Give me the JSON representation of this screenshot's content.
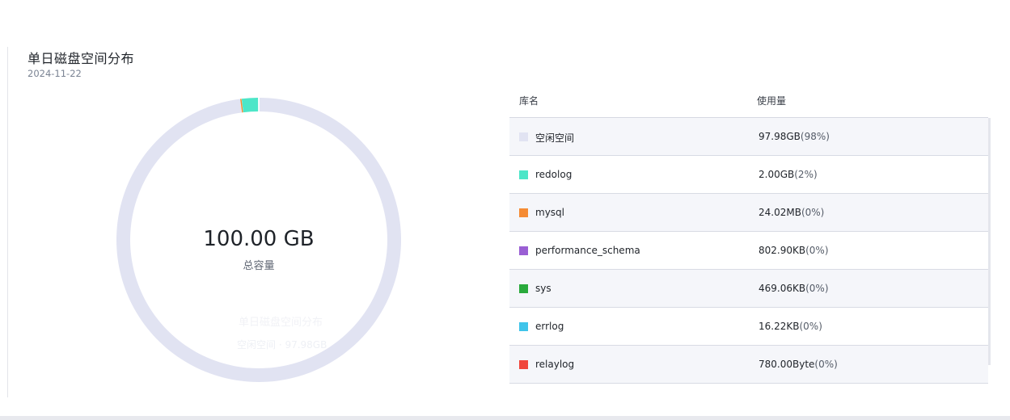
{
  "header": {
    "title": "单日磁盘空间分布",
    "date": "2024-11-22"
  },
  "donut": {
    "total_value": "100.00 GB",
    "total_label": "总容量",
    "ghost_title": "单日磁盘空间分布",
    "ghost_sub": "空闲空间 · 97.98GB"
  },
  "table": {
    "columns": [
      "库名",
      "使用量"
    ],
    "rows": [
      {
        "name": "空闲空间",
        "amount": "97.98GB",
        "pct": "(98%)",
        "color": "#e1e3f2",
        "value_gb": 97.98
      },
      {
        "name": "redolog",
        "amount": "2.00GB",
        "pct": "(2%)",
        "color": "#4de6c8",
        "value_gb": 2.0
      },
      {
        "name": "mysql",
        "amount": "24.02MB",
        "pct": "(0%)",
        "color": "#f58b34",
        "value_gb": 0.02346
      },
      {
        "name": "performance_schema",
        "amount": "802.90KB",
        "pct": "(0%)",
        "color": "#9a5fd4",
        "value_gb": 0.000766
      },
      {
        "name": "sys",
        "amount": "469.06KB",
        "pct": "(0%)",
        "color": "#2aaa3c",
        "value_gb": 0.000447
      },
      {
        "name": "errlog",
        "amount": "16.22KB",
        "pct": "(0%)",
        "color": "#3fc4ea",
        "value_gb": 1.55e-05
      },
      {
        "name": "relaylog",
        "amount": "780.00Byte",
        "pct": "(0%)",
        "color": "#f0463c",
        "value_gb": 7.3e-07
      }
    ]
  }
}
